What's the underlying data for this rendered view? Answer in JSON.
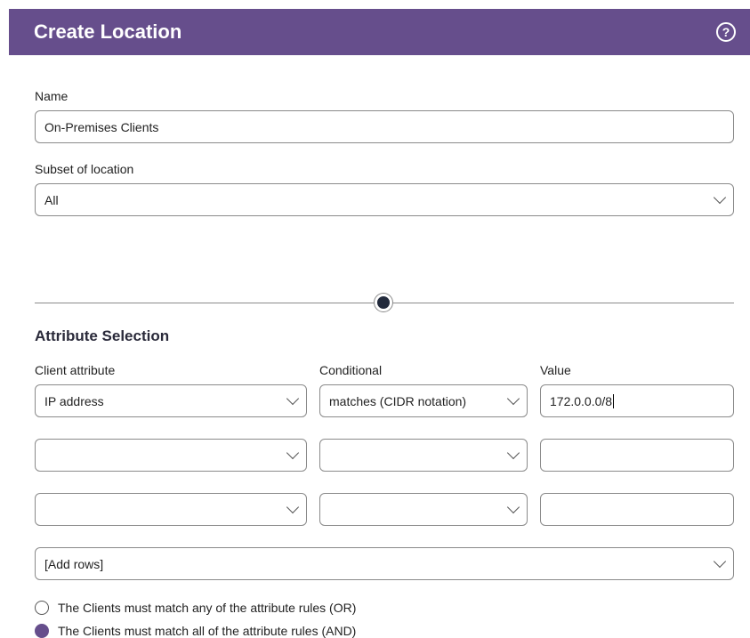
{
  "dialog": {
    "title": "Create Location",
    "help_icon": "help-circle-icon"
  },
  "form": {
    "name_label": "Name",
    "name_value": "On-Premises Clients",
    "subset_label": "Subset of location",
    "subset_value": "All"
  },
  "attributes": {
    "section_title": "Attribute Selection",
    "col_client_attribute": "Client attribute",
    "col_conditional": "Conditional",
    "col_value": "Value",
    "rows": [
      {
        "attribute": "IP address",
        "conditional": "matches (CIDR notation)",
        "value": "172.0.0.0/8"
      },
      {
        "attribute": "",
        "conditional": "",
        "value": ""
      },
      {
        "attribute": "",
        "conditional": "",
        "value": ""
      }
    ],
    "add_rows": "[Add rows]"
  },
  "match_mode": {
    "options": [
      {
        "label": "The Clients must match any of the attribute rules (OR)",
        "checked": false
      },
      {
        "label": "The Clients must match all of the attribute rules (AND)",
        "checked": true
      }
    ]
  },
  "colors": {
    "header_bg": "#664e8c",
    "accent": "#664e8c"
  }
}
